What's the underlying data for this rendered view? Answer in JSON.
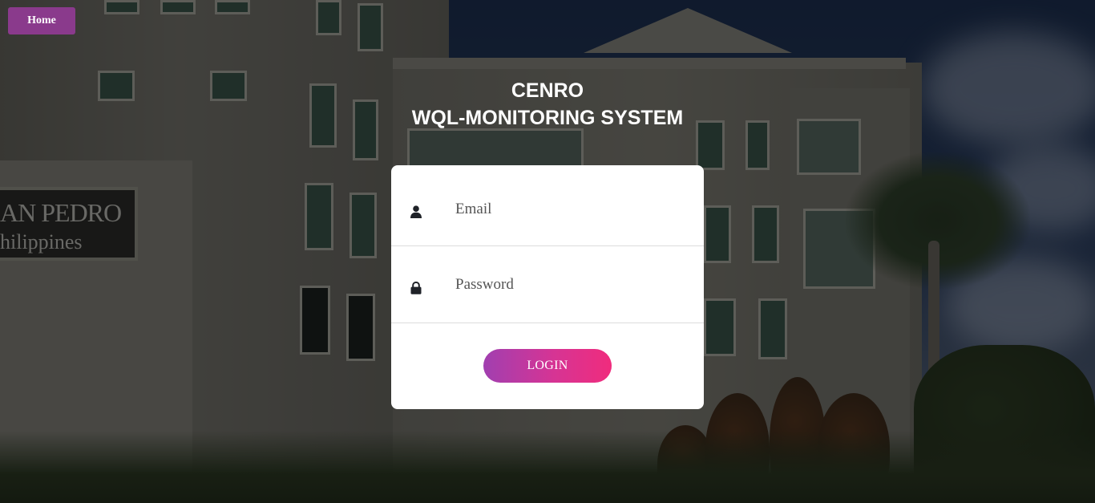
{
  "nav": {
    "home_label": "Home"
  },
  "header": {
    "line1": "CENRO",
    "line2": "WQL-MONITORING SYSTEM"
  },
  "background": {
    "sign_line1": "AN PEDRO",
    "sign_line2": "hilippines"
  },
  "login_form": {
    "email_placeholder": "Email",
    "email_icon": "user-icon",
    "password_placeholder": "Password",
    "password_icon": "lock-icon",
    "submit_label": "LOGIN"
  },
  "colors": {
    "home_button": "#8a3a8c",
    "login_gradient_start": "#a13fb0",
    "login_gradient_end": "#f02c7d",
    "card": "#ffffff"
  }
}
